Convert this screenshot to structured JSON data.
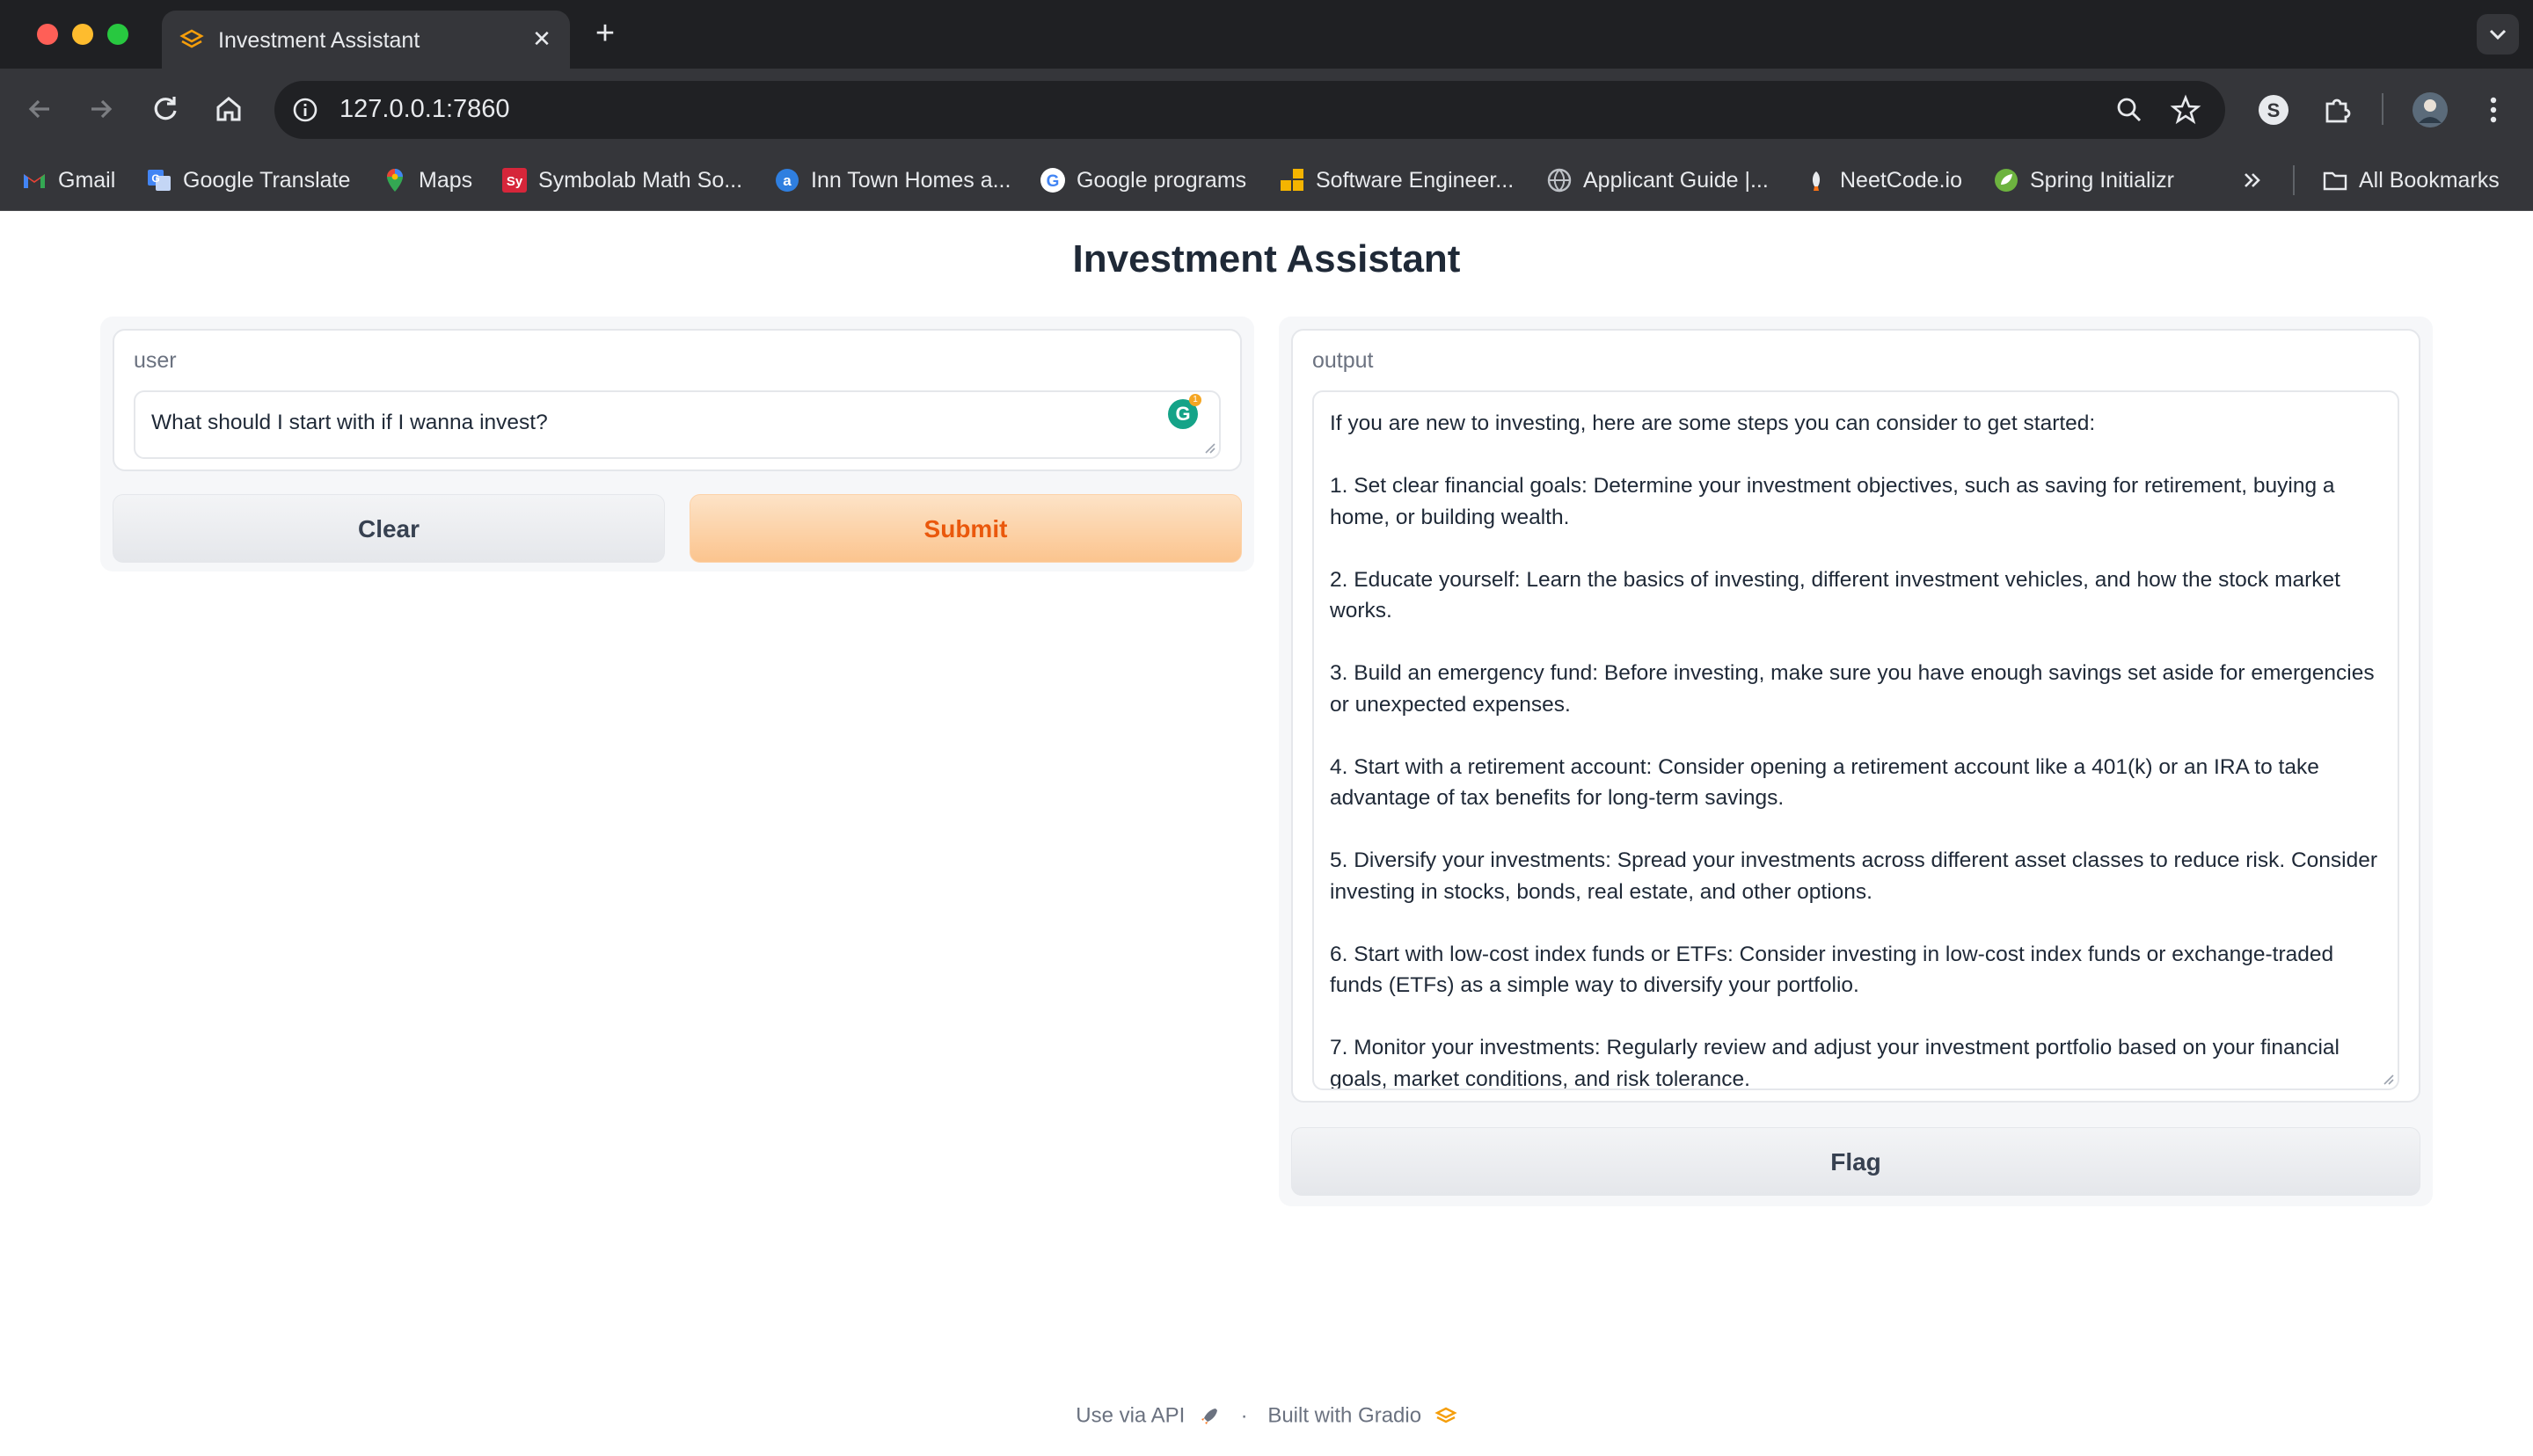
{
  "browser": {
    "tab_title": "Investment Assistant",
    "url": "127.0.0.1:7860",
    "bookmarks": [
      {
        "label": "Gmail",
        "icon": "gmail-icon"
      },
      {
        "label": "Google Translate",
        "icon": "google-translate-icon"
      },
      {
        "label": "Maps",
        "icon": "maps-icon"
      },
      {
        "label": "Symbolab Math So...",
        "icon": "symbolab-icon"
      },
      {
        "label": "Inn Town Homes a...",
        "icon": "inn-town-icon"
      },
      {
        "label": "Google programs",
        "icon": "google-icon"
      },
      {
        "label": "Software Engineer...",
        "icon": "software-engineer-icon"
      },
      {
        "label": "Applicant Guide |...",
        "icon": "globe-icon"
      },
      {
        "label": "NeetCode.io",
        "icon": "neetcode-icon"
      },
      {
        "label": "Spring Initializr",
        "icon": "spring-icon"
      }
    ],
    "all_bookmarks_label": "All Bookmarks",
    "profile_letter": "S"
  },
  "app": {
    "title": "Investment Assistant",
    "input": {
      "label": "user",
      "value": "What should I start with if I wanna invest?"
    },
    "clear_label": "Clear",
    "submit_label": "Submit",
    "output": {
      "label": "output",
      "paragraphs": [
        "If you are new to investing, here are some steps you can consider to get started:",
        "1. Set clear financial goals: Determine your investment objectives, such as saving for retirement, buying a home, or building wealth.",
        "2. Educate yourself: Learn the basics of investing, different investment vehicles, and how the stock market works.",
        "3. Build an emergency fund: Before investing, make sure you have enough savings set aside for emergencies or unexpected expenses.",
        "4. Start with a retirement account: Consider opening a retirement account like a 401(k) or an IRA to take advantage of tax benefits for long-term savings.",
        "5. Diversify your investments: Spread your investments across different asset classes to reduce risk. Consider investing in stocks, bonds, real estate, and other options.",
        "6. Start with low-cost index funds or ETFs: Consider investing in low-cost index funds or exchange-traded funds (ETFs) as a simple way to diversify your portfolio.",
        "7. Monitor your investments: Regularly review and adjust your investment portfolio based on your financial goals, market conditions, and risk tolerance."
      ]
    },
    "flag_label": "Flag",
    "footer": {
      "api_label": "Use via API",
      "separator": "·",
      "built_label": "Built with Gradio"
    },
    "grammarly_count": "1",
    "grammarly_letter": "G"
  },
  "colors": {
    "accent": "#ea580c",
    "submit_bg": "#fbc48e",
    "chrome_dark": "#1f2023",
    "chrome_toolbar": "#35363a"
  }
}
